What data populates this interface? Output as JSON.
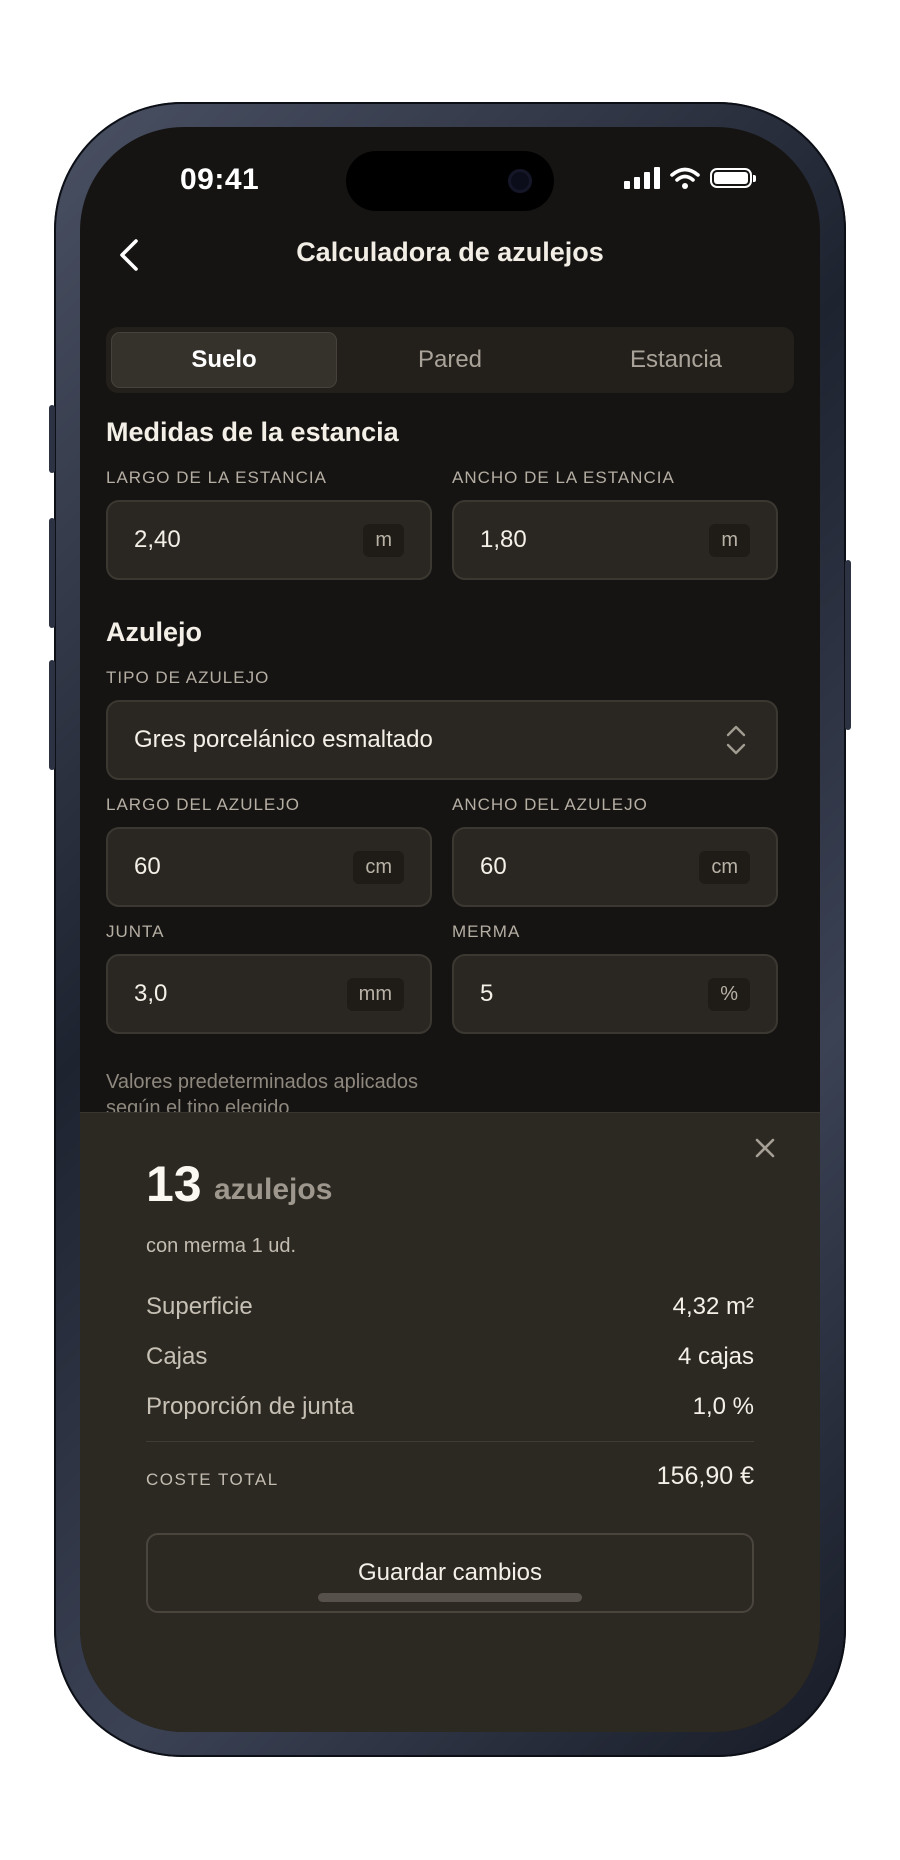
{
  "status_bar": {
    "time": "09:41"
  },
  "nav": {
    "title": "Calculadora de azulejos"
  },
  "tabs": [
    {
      "label": "Suelo",
      "active": true
    },
    {
      "label": "Pared",
      "active": false
    },
    {
      "label": "Estancia",
      "active": false
    }
  ],
  "room": {
    "heading": "Medidas de la estancia",
    "length": {
      "label": "LARGO DE LA ESTANCIA",
      "value": "2,40",
      "unit": "m"
    },
    "width": {
      "label": "ANCHO DE LA ESTANCIA",
      "value": "1,80",
      "unit": "m"
    }
  },
  "tile": {
    "heading": "Azulejo",
    "type": {
      "label": "TIPO DE AZULEJO",
      "value": "Gres porcelánico esmaltado"
    },
    "length": {
      "label": "LARGO DEL AZULEJO",
      "value": "60",
      "unit": "cm"
    },
    "width": {
      "label": "ANCHO DEL AZULEJO",
      "value": "60",
      "unit": "cm"
    },
    "joint": {
      "label": "JUNTA",
      "value": "3,0",
      "unit": "mm"
    },
    "waste": {
      "label": "MERMA",
      "value": "5",
      "unit": "%"
    },
    "hint": "Valores predeterminados aplicados según el tipo elegido"
  },
  "result": {
    "count": "13",
    "count_unit": "azulejos",
    "subtitle": "con merma 1 ud.",
    "rows": [
      {
        "label": "Superficie",
        "value": "4,32 m²"
      },
      {
        "label": "Cajas",
        "value": "4 cajas"
      },
      {
        "label": "Proporción de junta",
        "value": "1,0 %"
      }
    ],
    "total_label": "COSTE TOTAL",
    "total_value": "156,90 €",
    "save_label": "Guardar cambios"
  },
  "colors": {
    "background": "#151412",
    "sheet": "#2c2923",
    "field": "#2a2722"
  }
}
